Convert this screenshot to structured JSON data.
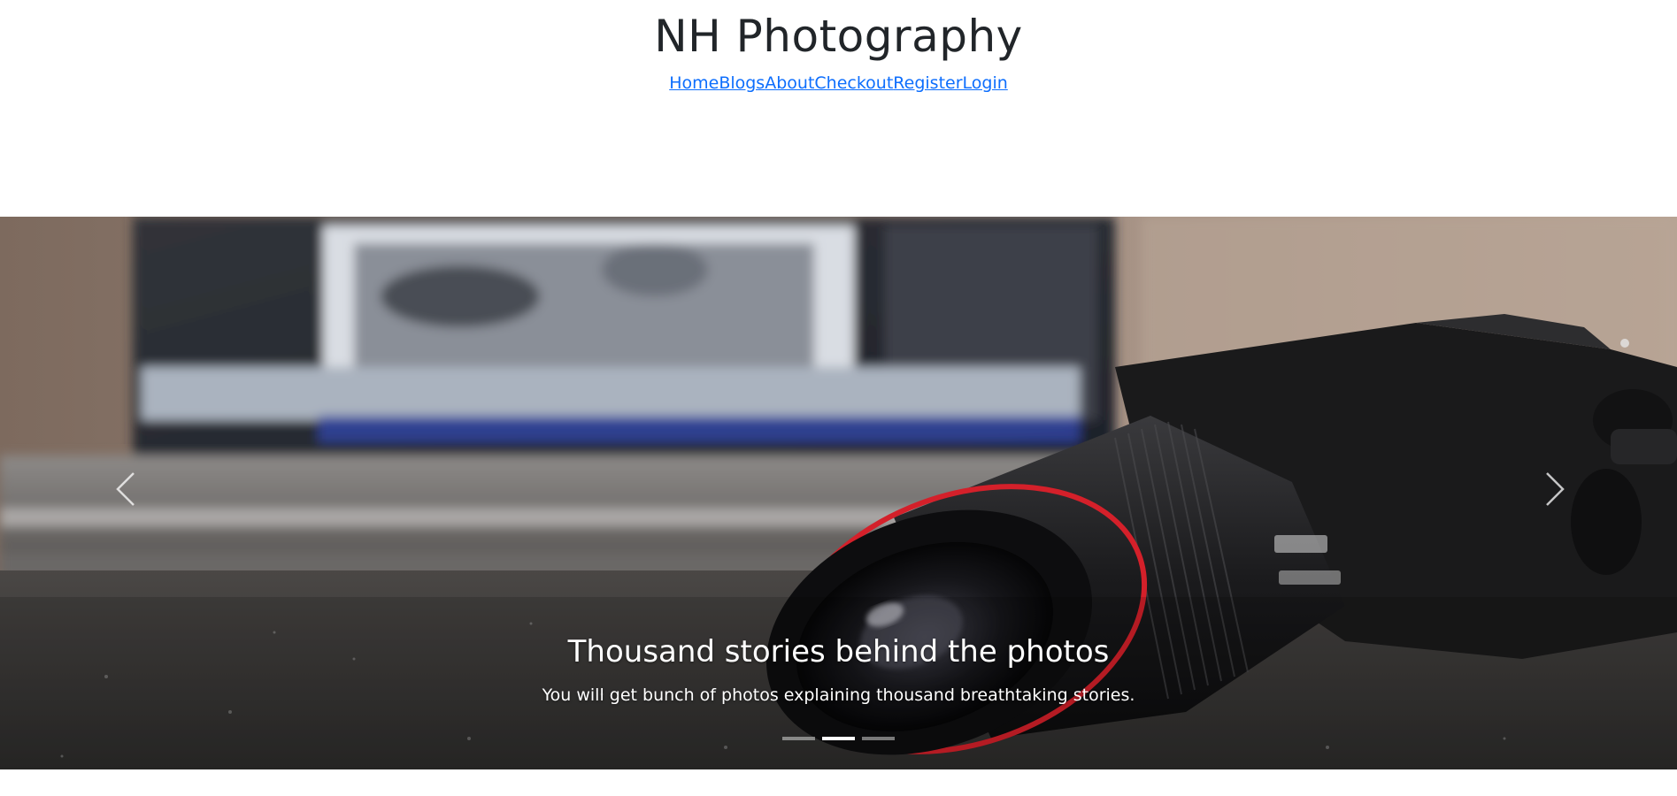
{
  "site": {
    "title": "NH Photography"
  },
  "nav": {
    "items": [
      {
        "label": "Home"
      },
      {
        "label": "Blogs"
      },
      {
        "label": "About"
      },
      {
        "label": "Checkout"
      },
      {
        "label": "Register"
      },
      {
        "label": "Login"
      }
    ]
  },
  "carousel": {
    "prev_icon": "chevron-left-icon",
    "next_icon": "chevron-right-icon",
    "active_slide_index": 1,
    "slide_count": 3,
    "caption": {
      "title": "Thousand stories behind the photos",
      "text": "You will get bunch of photos explaining thousand breathtaking stories."
    }
  },
  "colors": {
    "link": "#0d6efd",
    "title_text": "#212529",
    "caption_text": "#ffffff"
  }
}
